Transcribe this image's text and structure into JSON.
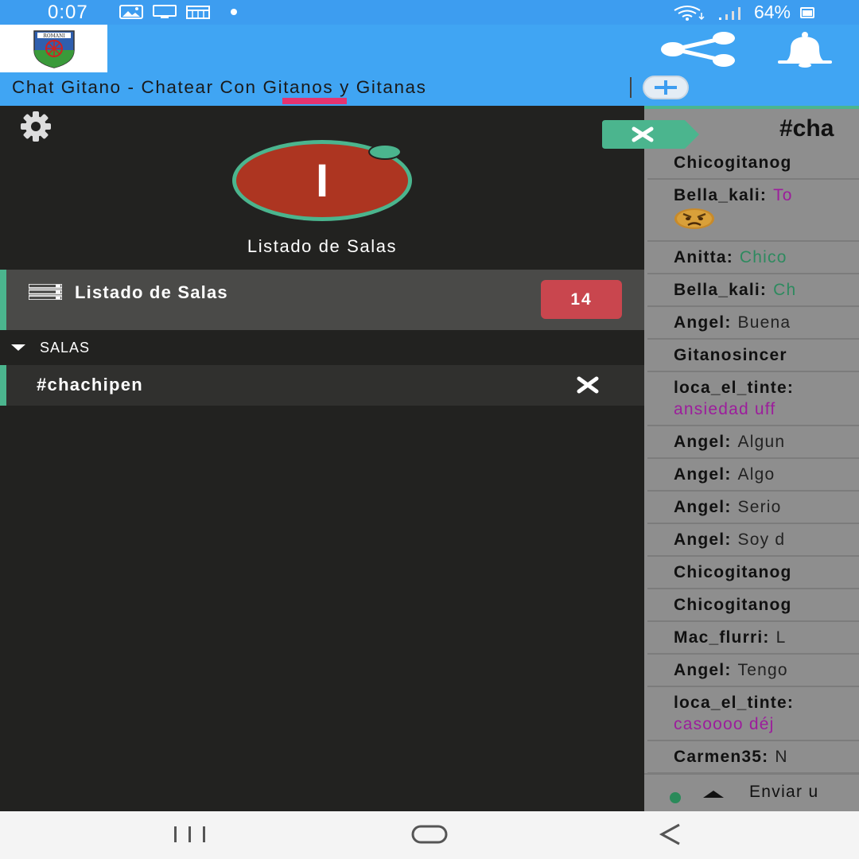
{
  "status_bar": {
    "time": "0:07",
    "battery": "64%"
  },
  "header": {
    "logo_text": "ROMANI",
    "title": "Chat Gitano - Chatear Con Gitanos y Gitanas"
  },
  "sidebar": {
    "avatar_letter": "I",
    "heading": "Listado de Salas",
    "rooms_item": {
      "label": "Listado de Salas",
      "count": "14"
    },
    "section_label": "SALAS",
    "channel": {
      "label": "#chachipen"
    }
  },
  "chat": {
    "title": "#cha",
    "messages": [
      {
        "nick": "Chicogitanog",
        "text": "",
        "color": "gray"
      },
      {
        "nick": "Bella_kali:",
        "text": "To",
        "color": "magenta",
        "emoji": "angry-face"
      },
      {
        "nick": "Anitta:",
        "text": "Chico",
        "color": "green"
      },
      {
        "nick": "Bella_kali:",
        "text": "Ch",
        "color": "green"
      },
      {
        "nick": "Angel:",
        "text": "Buena",
        "color": "gray"
      },
      {
        "nick": "Gitanosincer",
        "text": "",
        "color": "gray"
      },
      {
        "nick": "loca_el_tinte:",
        "text": "ansiedad uff",
        "color": "magenta",
        "wrap": true
      },
      {
        "nick": "Angel:",
        "text": "Algun",
        "color": "gray"
      },
      {
        "nick": "Angel:",
        "text": "Algo",
        "color": "gray"
      },
      {
        "nick": "Angel:",
        "text": "Serio",
        "color": "gray"
      },
      {
        "nick": "Angel:",
        "text": "Soy d",
        "color": "gray"
      },
      {
        "nick": "Chicogitanog",
        "text": "",
        "color": "gray"
      },
      {
        "nick": "Chicogitanog",
        "text": "",
        "color": "gray"
      },
      {
        "nick": "Mac_flurri:",
        "text": "L",
        "color": "gray"
      },
      {
        "nick": "Angel:",
        "text": "Tengo",
        "color": "gray"
      },
      {
        "nick": "loca_el_tinte:",
        "text": "casoooo déj",
        "color": "magenta",
        "wrap": true
      },
      {
        "nick": "Carmen35:",
        "text": "N",
        "color": "gray"
      }
    ],
    "input_placeholder": "Enviar u"
  },
  "colors": {
    "header_blue": "#40a5f3",
    "accent_green": "#4bb58e",
    "tab_indicator": "#e5336f",
    "badge_red": "#c9464e",
    "avatar_red": "#ad3521"
  },
  "icons": [
    "share-icon",
    "bell-icon",
    "gear-icon",
    "close-icon",
    "list-icon",
    "plus-icon"
  ]
}
